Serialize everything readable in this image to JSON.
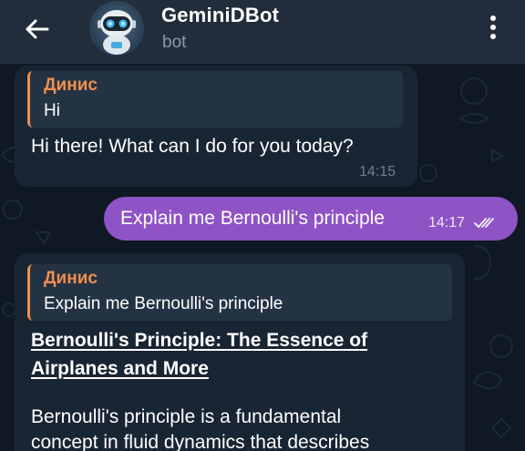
{
  "header": {
    "title": "GeminiDBot",
    "subtitle": "bot",
    "back_icon": "arrow-left-icon",
    "menu_icon": "more-vertical-icon",
    "background": "#212d3b"
  },
  "messages": [
    {
      "direction": "incoming",
      "reply_to": {
        "name": "Динис",
        "text": "Hi"
      },
      "text": "Hi there!   What can I do for you today?",
      "time": "14:15"
    },
    {
      "direction": "outgoing",
      "text": "Explain me Bernoulli's principle",
      "time": "14:17",
      "status_icon": "double-check-icon",
      "color": "#8e53c4"
    },
    {
      "direction": "incoming",
      "reply_to": {
        "name": "Динис",
        "text": "Explain me Bernoulli's principle"
      },
      "heading_line1": "Bernoulli's Principle:  The Essence of",
      "heading_line2": "Airplanes and More",
      "para_line1": "Bernoulli's principle is a fundamental",
      "para_line2": "concept in fluid dynamics that describes"
    }
  ],
  "colors": {
    "accent_reply": "#f18e4e",
    "incoming_bubble": "#182533",
    "chat_background": "#0f1923"
  }
}
